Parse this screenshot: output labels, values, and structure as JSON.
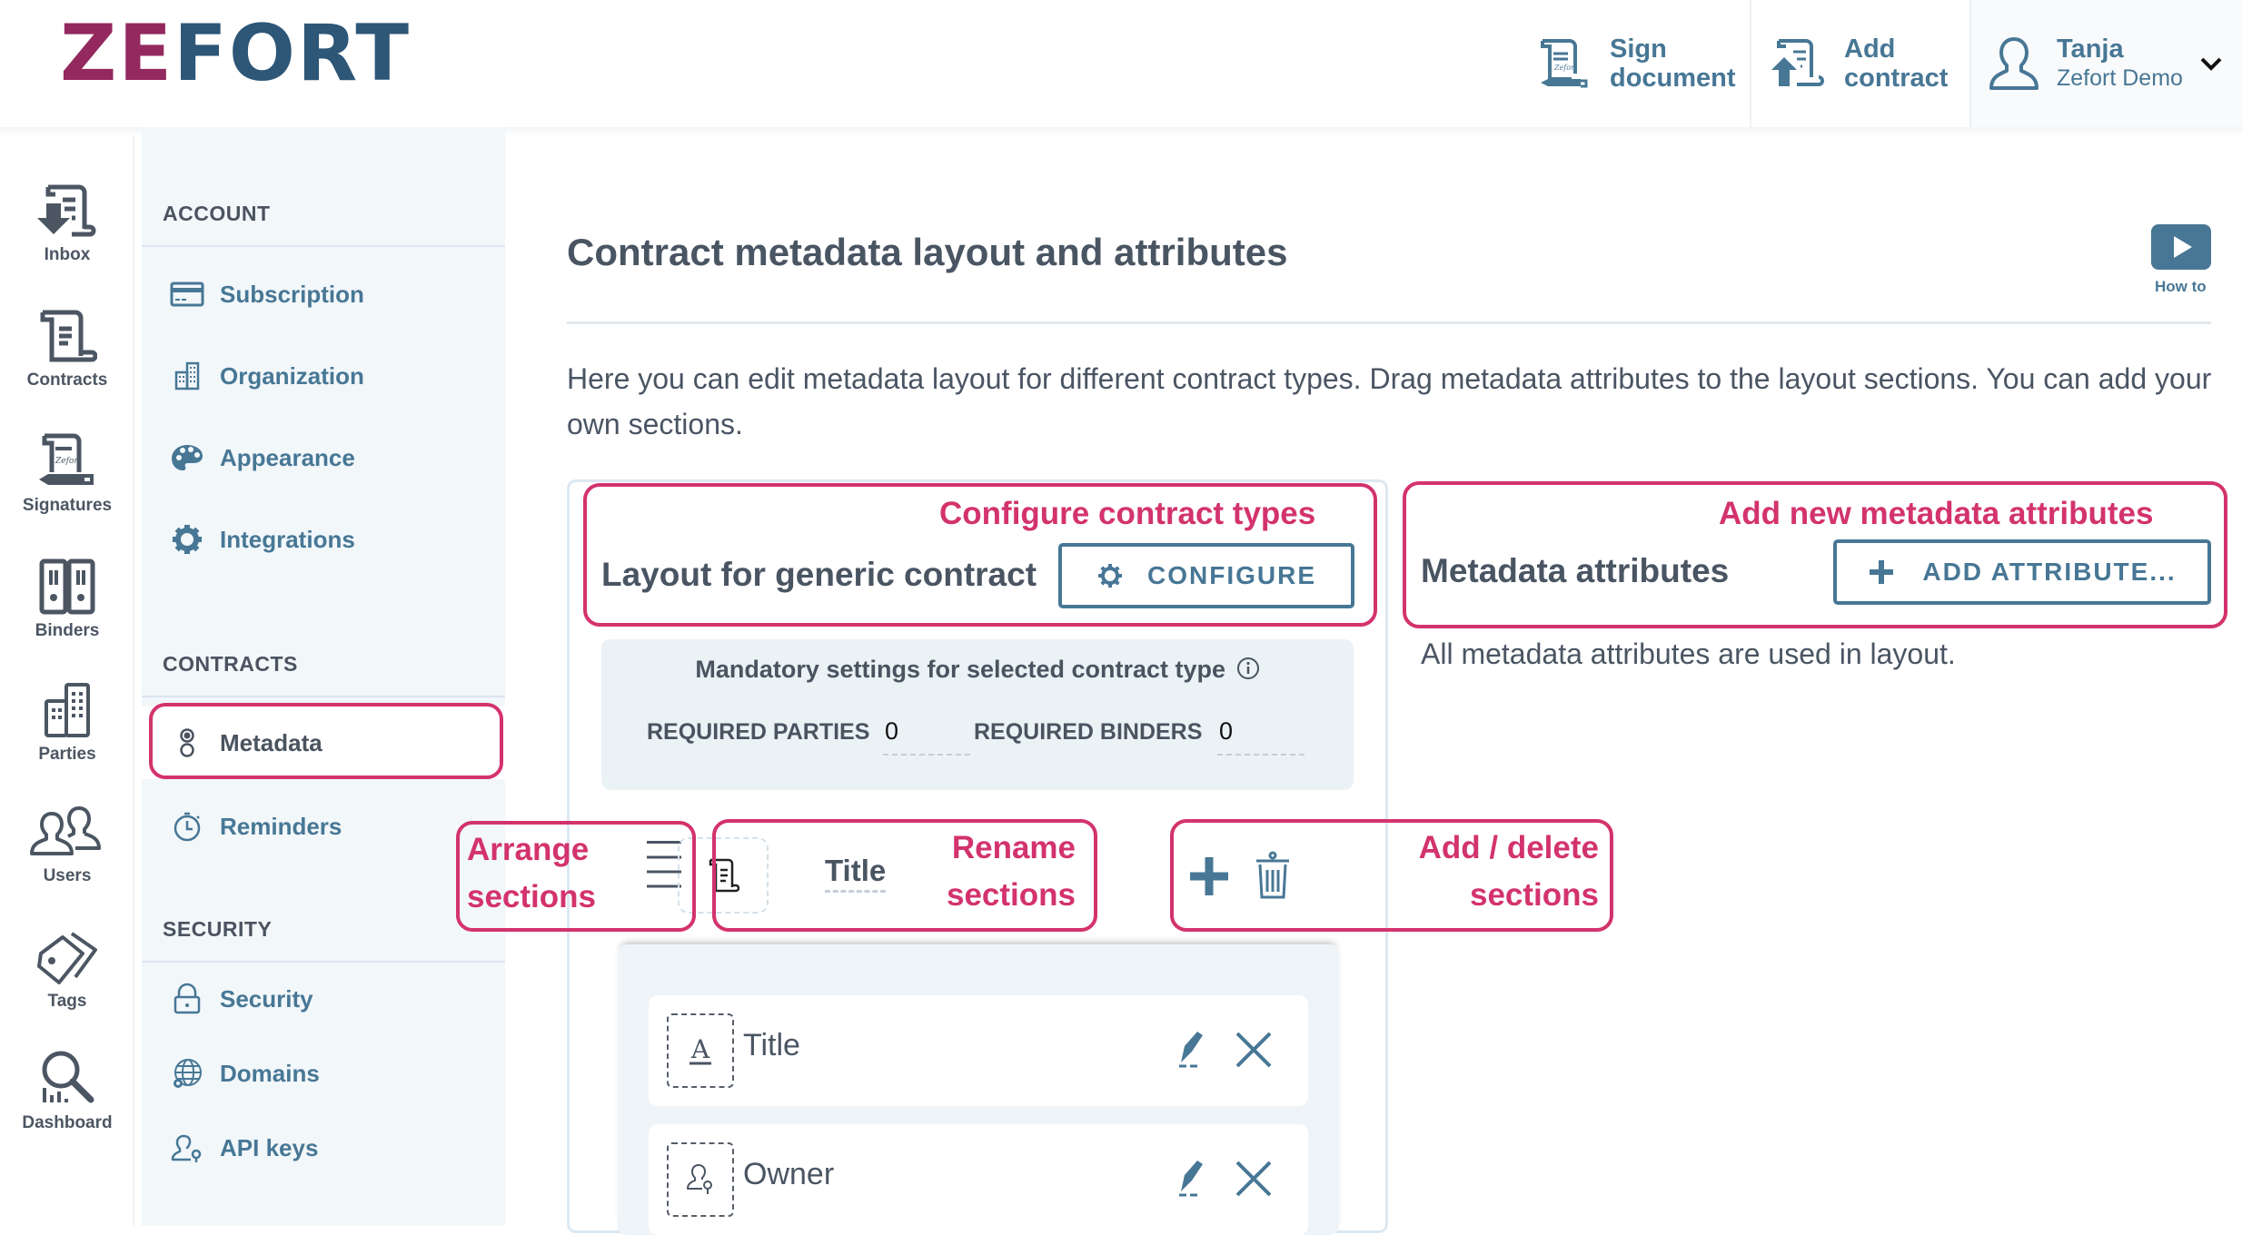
{
  "brand": {
    "logo_part1": "ZE",
    "logo_part2": "FORT",
    "colors": {
      "primary": "#477795",
      "accent_annotation": "#d3336d",
      "text": "#4a5563"
    }
  },
  "topbar": {
    "sign_document": {
      "line1": "Sign",
      "line2": "document",
      "icon": "sign-document-icon"
    },
    "add_contract": {
      "line1": "Add",
      "line2": "contract",
      "icon": "add-contract-icon"
    },
    "user": {
      "name": "Tanja",
      "organization": "Zefort Demo",
      "icon": "user-icon",
      "menu_icon": "chevron-down-icon"
    }
  },
  "rail": {
    "items": [
      {
        "label": "Inbox",
        "icon": "inbox-icon"
      },
      {
        "label": "Contracts",
        "icon": "contracts-icon"
      },
      {
        "label": "Signatures",
        "icon": "signatures-icon"
      },
      {
        "label": "Binders",
        "icon": "binders-icon"
      },
      {
        "label": "Parties",
        "icon": "parties-icon"
      },
      {
        "label": "Users",
        "icon": "users-icon"
      },
      {
        "label": "Tags",
        "icon": "tags-icon"
      },
      {
        "label": "Dashboard",
        "icon": "dashboard-icon"
      }
    ]
  },
  "sidebar": {
    "sections": [
      {
        "heading": "ACCOUNT",
        "items": [
          {
            "label": "Subscription",
            "icon": "credit-card-icon"
          },
          {
            "label": "Organization",
            "icon": "building-icon"
          },
          {
            "label": "Appearance",
            "icon": "palette-icon"
          },
          {
            "label": "Integrations",
            "icon": "gear-icon"
          }
        ]
      },
      {
        "heading": "CONTRACTS",
        "items": [
          {
            "label": "Metadata",
            "icon": "metadata-icon",
            "active": true
          },
          {
            "label": "Reminders",
            "icon": "stopwatch-icon"
          }
        ]
      },
      {
        "heading": "SECURITY",
        "items": [
          {
            "label": "Security",
            "icon": "lock-icon"
          },
          {
            "label": "Domains",
            "icon": "globe-icon"
          },
          {
            "label": "API keys",
            "icon": "user-key-icon"
          }
        ]
      }
    ]
  },
  "main": {
    "title": "Contract metadata layout and attributes",
    "howto_label": "How to",
    "description": "Here you can edit metadata layout for different contract types. Drag metadata attributes to the layout sections. You can add your own sections.",
    "layout": {
      "title": "Layout for generic contract",
      "configure_label": "CONFIGURE",
      "mandatory_title": "Mandatory settings for selected contract type",
      "required_parties_label": "REQUIRED PARTIES",
      "required_parties_value": "0",
      "required_binders_label": "REQUIRED BINDERS",
      "required_binders_value": "0",
      "section": {
        "name": "Title"
      },
      "attributes": [
        {
          "name": "Title",
          "icon": "text-attribute-icon"
        },
        {
          "name": "Owner",
          "icon": "owner-attribute-icon"
        }
      ]
    },
    "attributes_panel": {
      "title": "Metadata attributes",
      "add_label": "ADD ATTRIBUTE...",
      "info": "All metadata attributes are used in layout."
    }
  },
  "annotations": {
    "configure": "Configure contract types",
    "add_attributes": "Add new metadata attributes",
    "arrange_1": "Arrange",
    "arrange_2": "sections",
    "rename_1": "Rename",
    "rename_2": "sections",
    "adddel_1": "Add / delete",
    "adddel_2": "sections"
  }
}
